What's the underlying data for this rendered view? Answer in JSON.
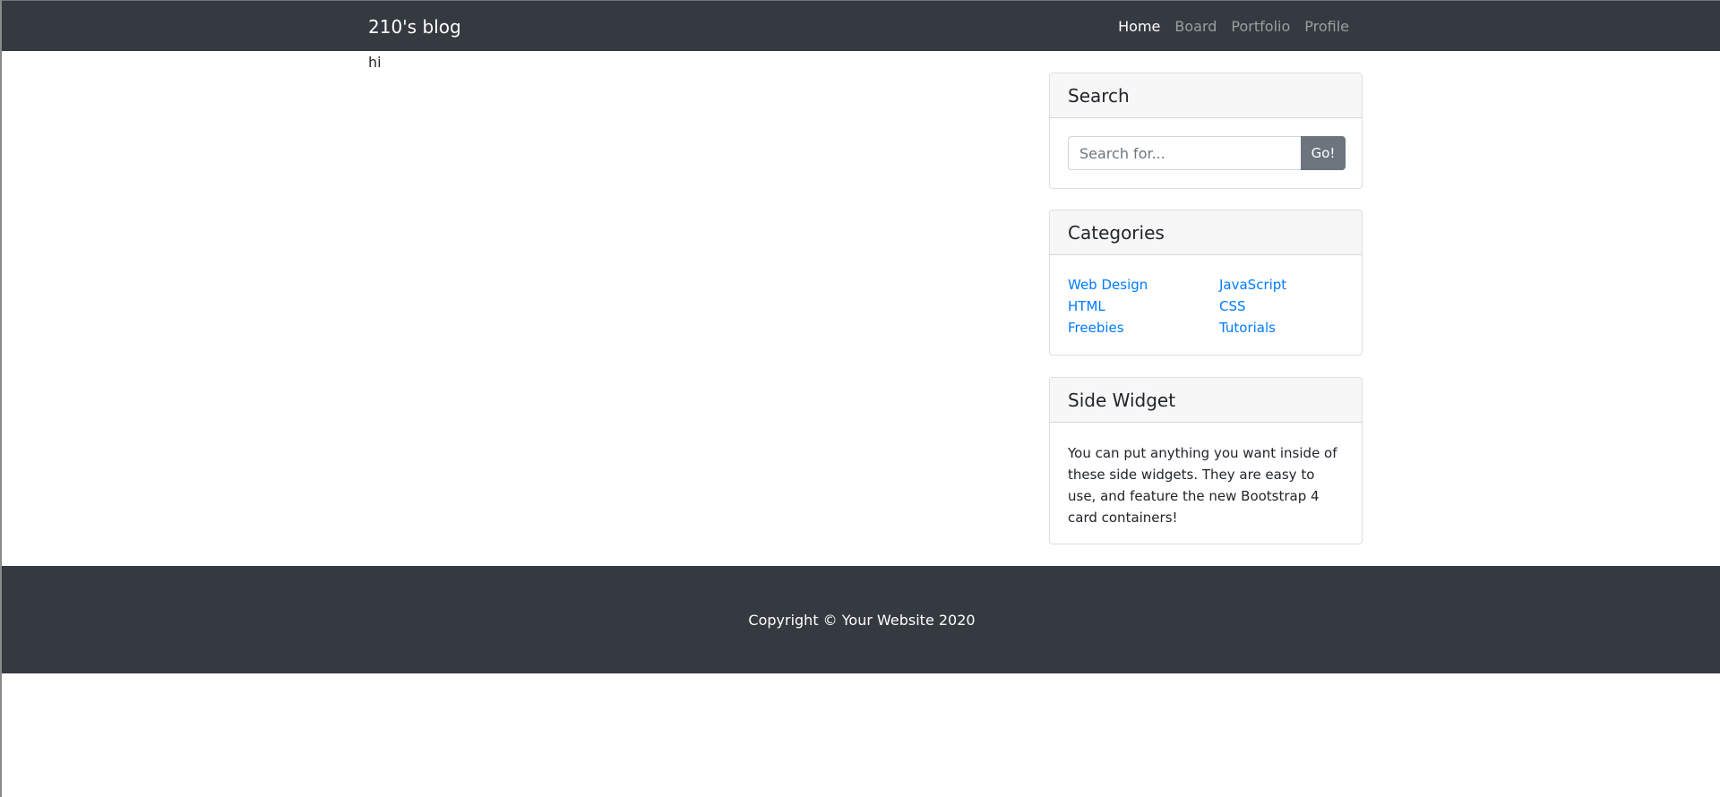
{
  "navbar": {
    "brand": "210's blog",
    "links": [
      {
        "label": "Home"
      },
      {
        "label": "Board"
      },
      {
        "label": "Portfolio"
      },
      {
        "label": "Profile"
      }
    ]
  },
  "main": {
    "text": "hi"
  },
  "sidebar": {
    "search": {
      "title": "Search",
      "placeholder": "Search for...",
      "button_label": "Go!"
    },
    "categories": {
      "title": "Categories",
      "items": [
        "Web Design",
        "JavaScript",
        "HTML",
        "CSS",
        "Freebies",
        "Tutorials"
      ]
    },
    "widget": {
      "title": "Side Widget",
      "text": "You can put anything you want inside of these side widgets. They are easy to use, and feature the new Bootstrap 4 card containers!"
    }
  },
  "footer": {
    "copyright": "Copyright © Your Website 2020"
  },
  "colors": {
    "navbar_bg": "#343a40",
    "link": "#007bff",
    "button_secondary": "#6c757d"
  }
}
